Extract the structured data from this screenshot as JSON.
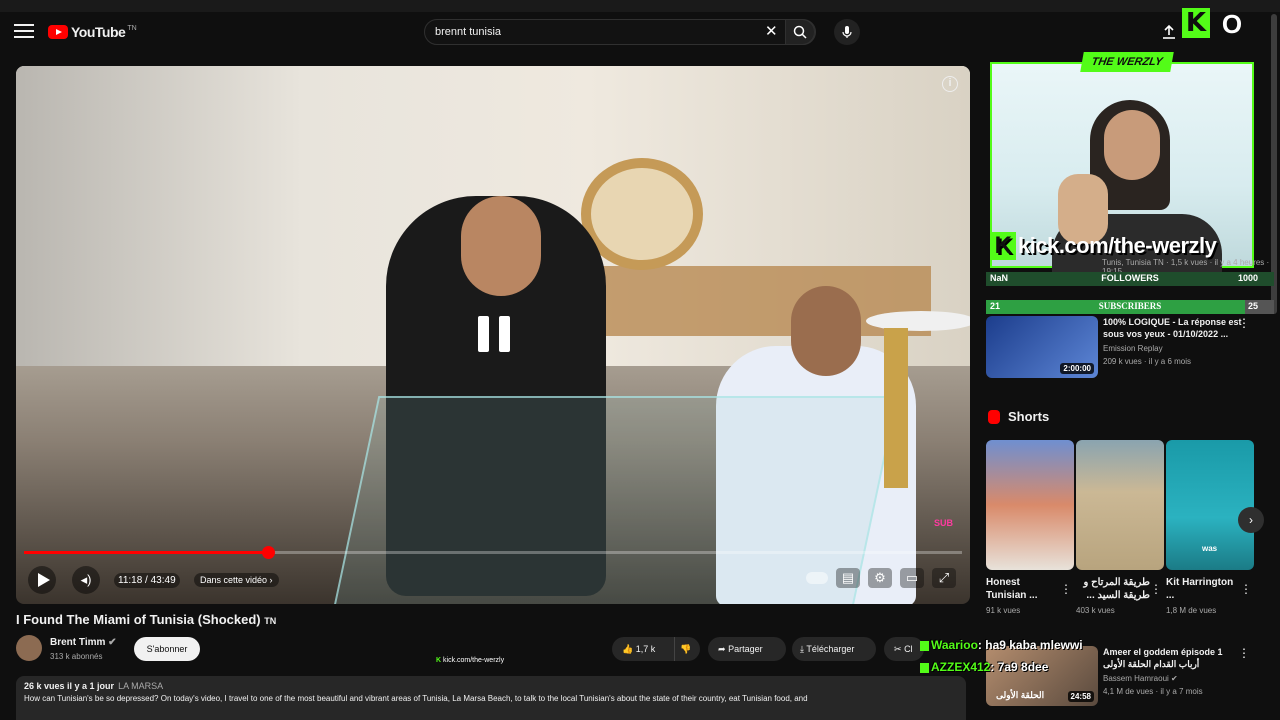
{
  "header": {
    "logo_text": "YouTube",
    "logo_country": "TN",
    "search_value": "brennt tunisia",
    "avatar_letter": "O",
    "kick_logo_letter": "K"
  },
  "player": {
    "time": "11:18 / 43:49",
    "chapter": "Dans cette vidéo",
    "progress_fraction": 0.26,
    "watermark": "SUB"
  },
  "video": {
    "title": "I Found The Miami of Tunisia (Shocked)",
    "title_suffix": "TN",
    "channel": "Brent Timm",
    "subscribers": "313 k abonnés",
    "subscribe_label": "S'abonner",
    "likes": "1,7 k",
    "share_label": "Partager",
    "download_label": "Télécharger",
    "clip_label": "Cl",
    "meta": "26 k vues  il y a 1 jour",
    "location": "LA MARSA",
    "description": "How can Tunisian's be so depressed? On today's video, I travel to one of the most beautiful and vibrant areas of Tunisia, La Marsa Beach, to talk to the local Tunisian's about the state of their country, eat Tunisian food, and",
    "kick_small": "kick.com/the-werzly"
  },
  "stream": {
    "badge": "THE WERZLY",
    "url": "kick.com/the-werzly",
    "followers_left": "NaN",
    "followers_label": "FOLLOWERS",
    "followers_count": "1000",
    "subs_left": "21",
    "subs_label": "SUBSCRIBERS",
    "subs_count": "25",
    "under_text": "Tunis, Tunisia TN",
    "under_views": "1,5 k vues · il y a 4 heures",
    "under_time": "19:15"
  },
  "recommendations": [
    {
      "title": "100% LOGIQUE - La réponse est sous vos yeux - 01/10/2022 ...",
      "channel": "Emission Replay",
      "stats": "209 k vues · il y a 6 mois",
      "duration": "2:00:00"
    },
    {
      "title": "Ameer el goddem épisode 1 أرباب القدام الحلقة الأولى",
      "channel": "Bassem Hamraoui",
      "stats": "4,1 M de vues · il y a 7 mois",
      "duration": "24:58",
      "thumb_text": "الحلقة الأولى"
    }
  ],
  "shorts": {
    "heading": "Shorts",
    "items": [
      {
        "title": "Honest Tunisian ...",
        "views": "91 k vues"
      },
      {
        "title": "طريقة المرتاح و طريقة السيد ...",
        "views": "403 k vues"
      },
      {
        "title": "Kit Harrington ...",
        "views": "1,8 M de vues",
        "overlay": "was"
      }
    ]
  },
  "chat": [
    {
      "user": "Waarioo",
      "message": ": ha9 kaba mlewwi"
    },
    {
      "user": "AZZEX412",
      "message": ": 7a9 8dee"
    }
  ],
  "colors": {
    "accent": "#ff0000",
    "kick": "#53fc18",
    "bg": "#0f0f0f"
  }
}
